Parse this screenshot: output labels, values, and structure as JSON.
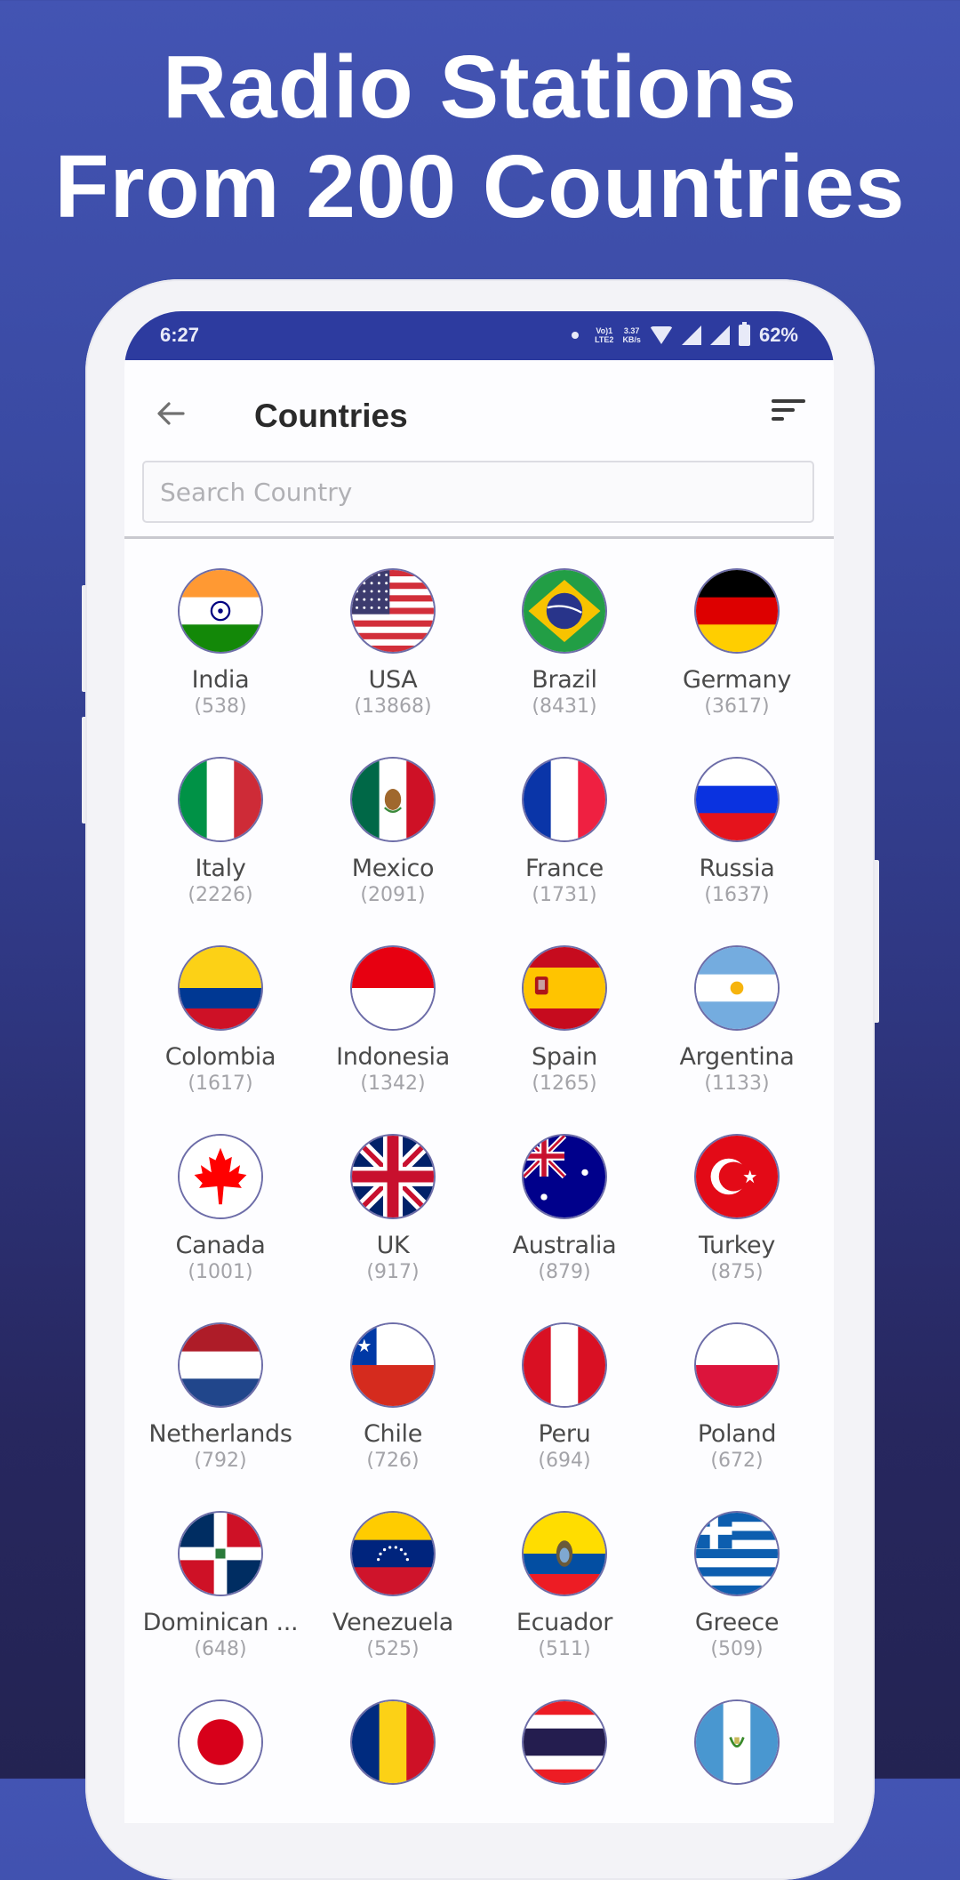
{
  "headline": {
    "line1": "Radio Stations",
    "line2": "From 200 Countries"
  },
  "status_bar": {
    "time": "6:27",
    "network_top": "Vo)1",
    "network_bottom": "LTE2",
    "speed_top": "3.37",
    "speed_bottom": "KB/s",
    "battery": "62%"
  },
  "app_bar": {
    "title": "Countries",
    "back_icon": "arrow-left-icon",
    "sort_icon": "sort-icon"
  },
  "search": {
    "placeholder": "Search Country",
    "value": ""
  },
  "countries": [
    {
      "name": "India",
      "count": "(538)",
      "flag": "india"
    },
    {
      "name": "USA",
      "count": "(13868)",
      "flag": "usa"
    },
    {
      "name": "Brazil",
      "count": "(8431)",
      "flag": "brazil"
    },
    {
      "name": "Germany",
      "count": "(3617)",
      "flag": "germany"
    },
    {
      "name": "Italy",
      "count": "(2226)",
      "flag": "italy"
    },
    {
      "name": "Mexico",
      "count": "(2091)",
      "flag": "mexico"
    },
    {
      "name": "France",
      "count": "(1731)",
      "flag": "france"
    },
    {
      "name": "Russia",
      "count": "(1637)",
      "flag": "russia"
    },
    {
      "name": "Colombia",
      "count": "(1617)",
      "flag": "colombia"
    },
    {
      "name": "Indonesia",
      "count": "(1342)",
      "flag": "indonesia"
    },
    {
      "name": "Spain",
      "count": "(1265)",
      "flag": "spain"
    },
    {
      "name": "Argentina",
      "count": "(1133)",
      "flag": "argentina"
    },
    {
      "name": "Canada",
      "count": "(1001)",
      "flag": "canada"
    },
    {
      "name": "UK",
      "count": "(917)",
      "flag": "uk"
    },
    {
      "name": "Australia",
      "count": "(879)",
      "flag": "australia"
    },
    {
      "name": "Turkey",
      "count": "(875)",
      "flag": "turkey"
    },
    {
      "name": "Netherlands",
      "count": "(792)",
      "flag": "netherlands"
    },
    {
      "name": "Chile",
      "count": "(726)",
      "flag": "chile"
    },
    {
      "name": "Peru",
      "count": "(694)",
      "flag": "peru"
    },
    {
      "name": "Poland",
      "count": "(672)",
      "flag": "poland"
    },
    {
      "name": "Dominican ...",
      "count": "(648)",
      "flag": "dominican-republic"
    },
    {
      "name": "Venezuela",
      "count": "(525)",
      "flag": "venezuela"
    },
    {
      "name": "Ecuador",
      "count": "(511)",
      "flag": "ecuador"
    },
    {
      "name": "Greece",
      "count": "(509)",
      "flag": "greece"
    },
    {
      "name": "",
      "count": "",
      "flag": "japan"
    },
    {
      "name": "",
      "count": "",
      "flag": "romania"
    },
    {
      "name": "",
      "count": "",
      "flag": "thailand"
    },
    {
      "name": "",
      "count": "",
      "flag": "guatemala"
    }
  ]
}
